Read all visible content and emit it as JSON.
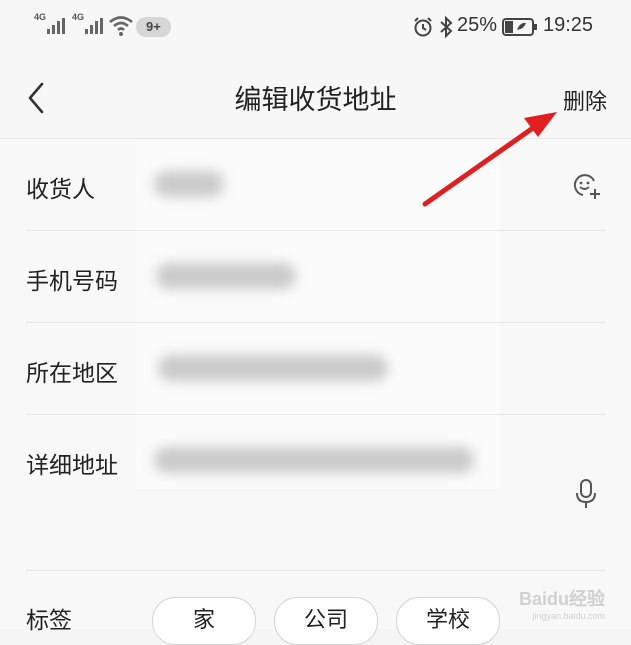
{
  "status_bar": {
    "signal_1_tag": "4G",
    "signal_2_tag": "4G",
    "notification_badge": "9+",
    "battery_percent": "25%",
    "time": "19:25"
  },
  "header": {
    "title": "编辑收货地址",
    "delete_label": "删除"
  },
  "form": {
    "fields": [
      {
        "label": "收货人"
      },
      {
        "label": "手机号码"
      },
      {
        "label": "所在地区"
      },
      {
        "label": "详细地址"
      }
    ],
    "tag_label": "标签",
    "tags": [
      "家",
      "公司",
      "学校"
    ]
  },
  "icons": {
    "back": "chevron-left-icon",
    "contact": "add-contact-icon",
    "mic": "microphone-icon",
    "alarm": "alarm-icon",
    "bluetooth": "bluetooth-icon",
    "wifi": "wifi-icon",
    "battery": "battery-icon"
  },
  "colors": {
    "annotation_arrow": "#e02020"
  },
  "watermark": {
    "brand": "Baidu经验",
    "url": "jingyan.baidu.com"
  }
}
